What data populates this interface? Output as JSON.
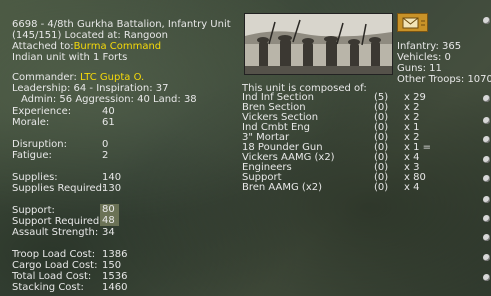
{
  "header": {
    "title": "6698 - 4/8th Gurkha Battalion, Infantry Unit",
    "strength_location": "(145/151) Located at: Rangoon",
    "attached_label": "Attached to:",
    "attached_value": "Burma Command",
    "nationality_forts": "Indian unit with 1 Forts"
  },
  "commander": {
    "label": "Commander:",
    "name": "LTC Gupta O.",
    "leadership": "Leadership: 64 - Inspiration: 37",
    "admin": "Admin: 56  Aggression: 40  Land: 38"
  },
  "stats": [
    {
      "label": "Experience:",
      "value": "40"
    },
    {
      "label": "Morale:",
      "value": "61"
    },
    {
      "label": "Disruption:",
      "value": "0"
    },
    {
      "label": "Fatigue:",
      "value": "2"
    },
    {
      "label": "Supplies:",
      "value": "140"
    },
    {
      "label": "Supplies Required:",
      "value": "130"
    },
    {
      "label": "Support:",
      "value": "80"
    },
    {
      "label": "Support Required:",
      "value": "48"
    },
    {
      "label": "Assault Strength:",
      "value": "34"
    },
    {
      "label": "Troop Load Cost:",
      "value": "1386"
    },
    {
      "label": "Cargo Load Cost:",
      "value": "150"
    },
    {
      "label": "Total Load Cost:",
      "value": "1536"
    },
    {
      "label": "Stacking Cost:",
      "value": "1460"
    }
  ],
  "summary": {
    "infantry": "Infantry: 365",
    "vehicles": "Vehicles: 0",
    "guns": "Guns: 11",
    "other": "Other Troops: 1070"
  },
  "composition": {
    "heading": "This unit is composed of:",
    "rows": [
      {
        "name": "Ind Inf Section",
        "count": "(5)",
        "qty": "x 29"
      },
      {
        "name": "Bren Section",
        "count": "(0)",
        "qty": "x 2"
      },
      {
        "name": "Vickers Section",
        "count": "(0)",
        "qty": "x 2"
      },
      {
        "name": "Ind Cmbt Eng",
        "count": "(0)",
        "qty": "x 1"
      },
      {
        "name": "3\" Mortar",
        "count": "(0)",
        "qty": "x 2"
      },
      {
        "name": "18 Pounder Gun",
        "count": "(0)",
        "qty": "x 1 ="
      },
      {
        "name": "Vickers AAMG (x2)",
        "count": "(0)",
        "qty": "x 4"
      },
      {
        "name": "Engineers",
        "count": "(0)",
        "qty": "x 3"
      },
      {
        "name": "Support",
        "count": "(0)",
        "qty": "x 80"
      },
      {
        "name": "Bren AAMG (x2)",
        "count": "(0)",
        "qty": "x 4"
      }
    ]
  },
  "colors": {
    "highlight_text": "#f5d90a",
    "text": "#e8e8e8",
    "envelope": "#c89228"
  },
  "icons": {
    "mail": "envelope-icon",
    "photo": "unit-photo"
  }
}
